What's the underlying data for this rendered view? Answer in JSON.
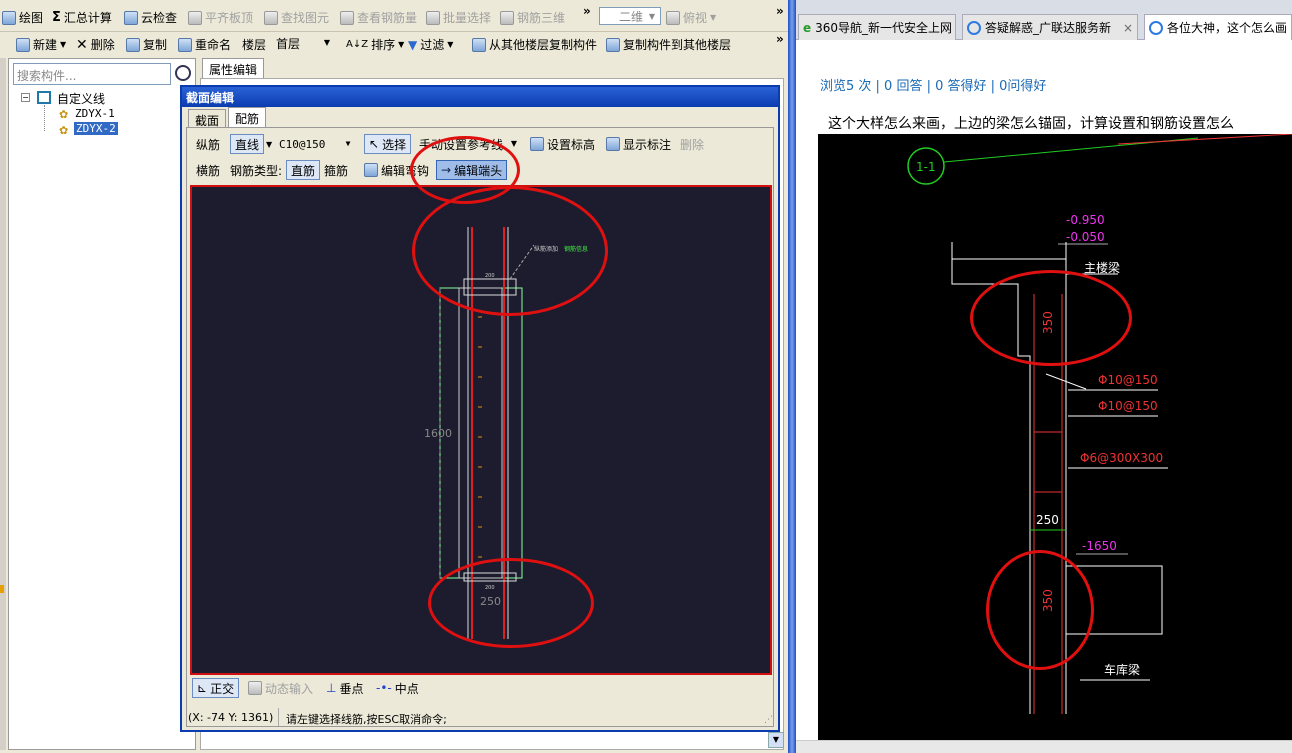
{
  "toolbar1": {
    "items": [
      {
        "label": "绘图",
        "icon": "draw-icon",
        "disabled": false
      },
      {
        "label": "汇总计算",
        "icon": "sigma-icon",
        "disabled": false
      },
      {
        "label": "云检查",
        "icon": "cloud-check-icon",
        "disabled": false
      },
      {
        "label": "平齐板顶",
        "icon": "align-top-icon",
        "disabled": true
      },
      {
        "label": "查找图元",
        "icon": "find-element-icon",
        "disabled": true
      },
      {
        "label": "查看钢筋量",
        "icon": "view-rebar-icon",
        "disabled": true
      },
      {
        "label": "批量选择",
        "icon": "batch-select-icon",
        "disabled": true
      },
      {
        "label": "钢筋三维",
        "icon": "rebar-3d-icon",
        "disabled": true
      }
    ],
    "view_mode": "二维",
    "view_angle": "俯视",
    "more": "»"
  },
  "toolbar2": {
    "new": "新建",
    "delete": "删除",
    "copy": "复制",
    "rename": "重命名",
    "floor_label": "楼层",
    "floor_value": "首层",
    "sort": "排序",
    "filter": "过滤",
    "copy_from_floor": "从其他楼层复制构件",
    "copy_to_floor": "复制构件到其他楼层",
    "more": "»"
  },
  "left_panel": {
    "search_placeholder": "搜索构件...",
    "tree_root": "自定义线",
    "tree_items": [
      "ZDYX-1",
      "ZDYX-2"
    ],
    "selected_index": 1
  },
  "property_tab": "属性编辑",
  "dialog": {
    "title": "截面编辑",
    "tabs": [
      "截面",
      "配筋"
    ],
    "active_tab": 1,
    "row1": {
      "label": "纵筋",
      "mode": "直线",
      "spec": "C10@150",
      "select": "选择",
      "ref_line": "手动设置参考线",
      "set_elevation": "设置标高",
      "show_marks": "显示标注",
      "delete": "删除"
    },
    "row2": {
      "label": "横筋",
      "rebar_type_label": "钢筋类型:",
      "straight": "直筋",
      "stirrup": "箍筋",
      "edit_bend": "编辑弯钩",
      "edit_end": "编辑端头"
    },
    "canvas": {
      "dim_height": "1600",
      "dim_width": "250",
      "top_dim": "200",
      "bottom_dim": "200",
      "callout": "纵筋添加",
      "callout_value": "钢筋信息"
    },
    "status": {
      "ortho": "正交",
      "dynamic_input": "动态输入",
      "perpendicular": "垂点",
      "midpoint": "中点",
      "coords": "(X: -74 Y: 1361)",
      "message": "请左键选择线筋,按ESC取消命令;"
    }
  },
  "browser": {
    "tabs": [
      {
        "label": "360导航_新一代安全上网",
        "active": false
      },
      {
        "label": "答疑解惑_广联达服务新",
        "active": false
      },
      {
        "label": "各位大神，这个怎么画",
        "active": true
      }
    ],
    "stats": "浏览5 次 | 0 回答 | 0 答得好 | 0问得好",
    "question": "这个大样怎么来画，上边的梁怎么锚固，计算设置和钢筋设置怎么",
    "cad": {
      "section_mark": "1-1",
      "elev_top1": "-0.950",
      "elev_top2": "-0.050",
      "top_beam": "主楼梁",
      "dim_top": "350",
      "rebar1": "Φ10@150",
      "rebar2": "Φ10@150",
      "rebar3": "Φ6@300X300",
      "width": "250",
      "elev_bottom": "-1650",
      "dim_bottom": "350",
      "bottom_beam": "车库梁"
    }
  },
  "colors": {
    "dialog_title": "#0a3cb0",
    "canvas_bg": "#1c1c2e",
    "annotation_red": "#e01010",
    "selection": "#316ac5",
    "link_blue": "#1a6ab5"
  }
}
